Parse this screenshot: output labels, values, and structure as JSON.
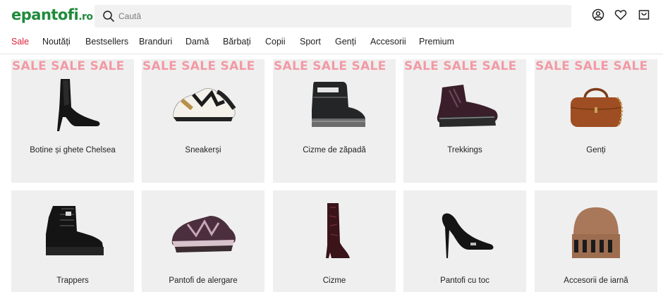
{
  "header": {
    "logo_main": "epantofi",
    "logo_tld": ".ro",
    "search_placeholder": "Caută",
    "icons": [
      "search-icon",
      "user-icon",
      "heart-icon",
      "cart-icon"
    ]
  },
  "nav": {
    "items": [
      "Sale",
      "Noutăți",
      "Bestsellers",
      "Branduri",
      "Damă",
      "Bărbați",
      "Copii",
      "Sport",
      "Genți",
      "Accesorii",
      "Premium"
    ]
  },
  "sale_banner": "SALE SALE SALE",
  "categories": [
    {
      "label": "Botine și ghete Chelsea",
      "icon": "ankle-boot-image"
    },
    {
      "label": "Sneakerși",
      "icon": "sneaker-image"
    },
    {
      "label": "Cizme de zăpadă",
      "icon": "snow-boot-image"
    },
    {
      "label": "Trekkings",
      "icon": "hiking-boot-image"
    },
    {
      "label": "Genți",
      "icon": "handbag-image"
    },
    {
      "label": "Trappers",
      "icon": "combat-boot-image"
    },
    {
      "label": "Pantofi de alergare",
      "icon": "trail-shoe-image"
    },
    {
      "label": "Cizme",
      "icon": "knee-boot-image"
    },
    {
      "label": "Pantofi cu toc",
      "icon": "pump-image"
    },
    {
      "label": "Accesorii de iarnă",
      "icon": "beanie-image"
    }
  ],
  "colors": {
    "brand_green": "#1f8a3b",
    "sale_red": "#e0203a",
    "banner_pink": "#f19aa5",
    "tile_bg": "#efefef"
  }
}
